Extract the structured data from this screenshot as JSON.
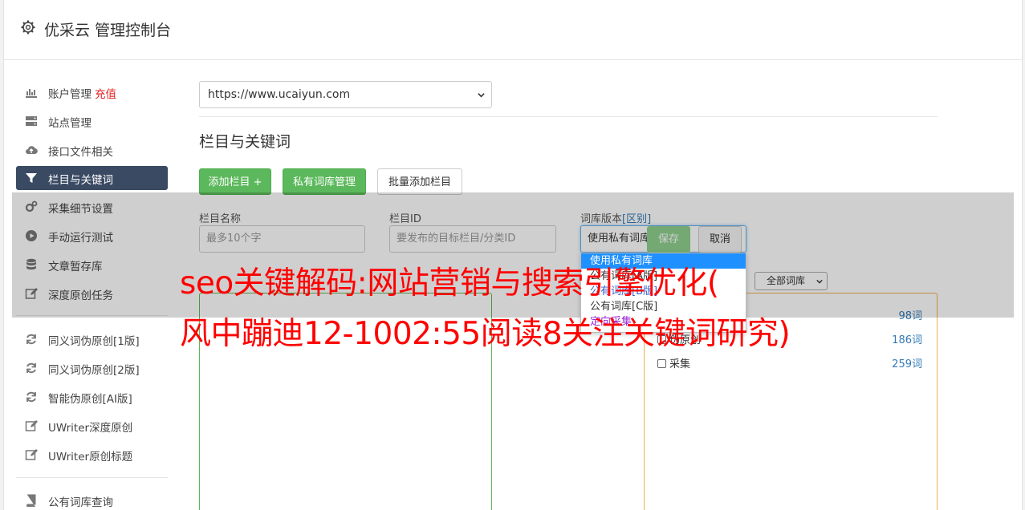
{
  "header": {
    "title": "优采云 管理控制台"
  },
  "sidebar": {
    "items": [
      {
        "label": "账户管理",
        "extra": "充值",
        "icon": "bar-chart-icon"
      },
      {
        "label": "站点管理",
        "icon": "server-icon"
      },
      {
        "label": "接口文件相关",
        "icon": "cloud-upload-icon"
      },
      {
        "label": "栏目与关键词",
        "icon": "filter-icon",
        "active": true
      },
      {
        "label": "采集细节设置",
        "icon": "cogs-icon"
      },
      {
        "label": "手动运行测试",
        "icon": "play-circle-icon"
      },
      {
        "label": "文章暂存库",
        "icon": "database-icon"
      },
      {
        "label": "深度原创任务",
        "icon": "edit-icon"
      },
      {
        "label": "同义词伪原创[1版]",
        "icon": "refresh-icon"
      },
      {
        "label": "同义词伪原创[2版]",
        "icon": "refresh-icon"
      },
      {
        "label": "智能伪原创[AI版]",
        "icon": "refresh-icon"
      },
      {
        "label": "UWriter深度原创",
        "icon": "edit-icon"
      },
      {
        "label": "UWriter原创标题",
        "icon": "edit-icon"
      },
      {
        "label": "公有词库查询",
        "icon": "book-icon"
      }
    ]
  },
  "site": {
    "selected": "https://www.ucaiyun.com"
  },
  "section": {
    "title": "栏目与关键词"
  },
  "buttons": {
    "add_column": "添加栏目 +",
    "private_lib": "私有词库管理",
    "batch_add": "批量添加栏目",
    "save": "保存",
    "cancel": "取消"
  },
  "form": {
    "name_label": "栏目名称",
    "name_placeholder": "最多10个字",
    "id_label": "栏目ID",
    "id_placeholder": "要发布的目标栏目/分类ID",
    "version_label": "词库版本",
    "version_link": "[区别]",
    "version_selected": "使用私有词库"
  },
  "dropdown": {
    "options": [
      "使用私有词库",
      "公有词库[A版]",
      "公有词库[B版]",
      "公有词库[C版]",
      "定向采集"
    ]
  },
  "libs": {
    "filter": "全部词库",
    "rows": [
      {
        "label": "",
        "count": "98词"
      },
      {
        "label": "伪原创",
        "count": "186词"
      },
      {
        "label": "采集",
        "count": "259词"
      }
    ]
  },
  "watermark": {
    "line1": "seo关键解码:网站营销与搜索引擎优化(",
    "line2": "风中蹦迪12-1002:55阅读8关注关键词研究)"
  },
  "colors": {
    "accent_green": "#5cb85c",
    "active_nav": "#3a4a63",
    "recharge": "#e02020",
    "watermark": "#ff0000"
  }
}
